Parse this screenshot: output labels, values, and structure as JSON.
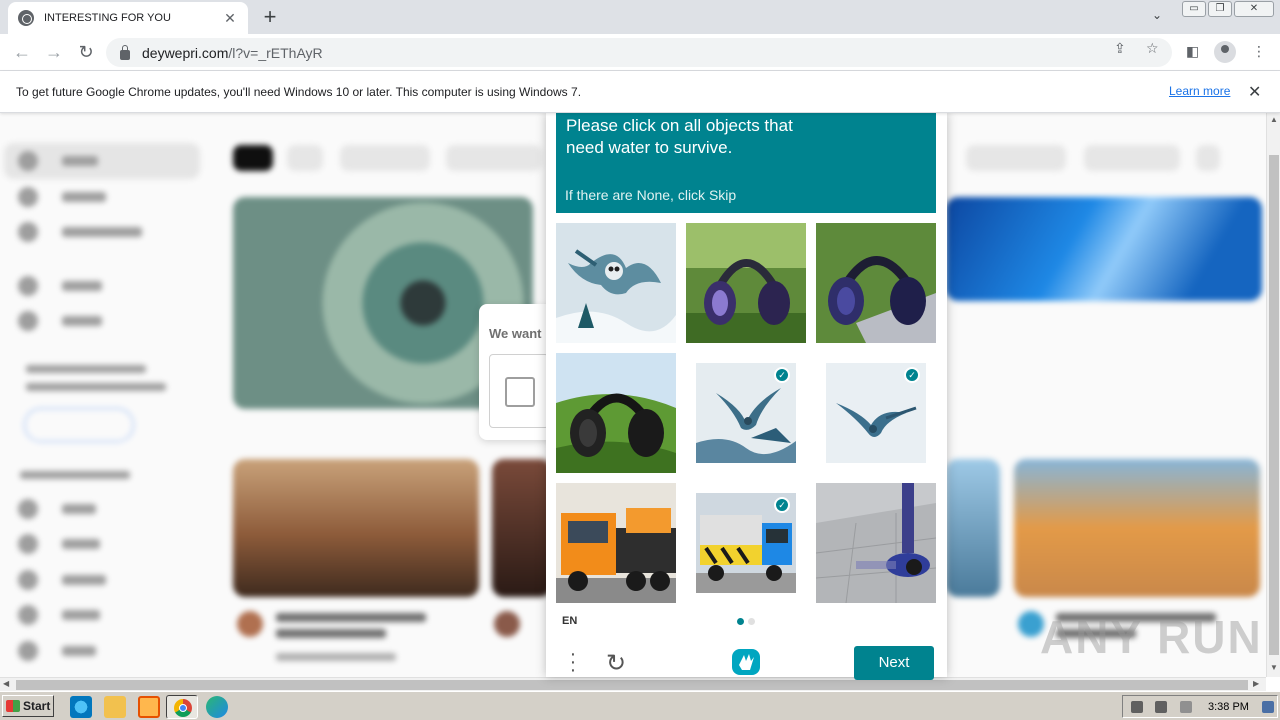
{
  "browser": {
    "tab_title": "INTERESTING FOR YOU",
    "tab_close": "✕",
    "new_tab": "+",
    "url_host": "deywepri.com",
    "url_path": "/l?v=_rEThAyR",
    "window_controls": [
      "▭",
      "❐",
      "✕"
    ]
  },
  "infobar": {
    "message": "To get future Google Chrome updates, you'll need Windows 10 or later. This computer is using Windows 7.",
    "link": "Learn more",
    "close": "✕"
  },
  "background_card": {
    "text": "We want"
  },
  "captcha": {
    "prompt": "Please click on all objects that need water to survive.",
    "skip_hint": "If there are None, click Skip",
    "accent_color": "#00838f",
    "tiles": [
      {
        "subject": "owl-flying-snow",
        "selected": false
      },
      {
        "subject": "headphones-on-grass",
        "selected": false
      },
      {
        "subject": "headphones-on-laptop",
        "selected": false
      },
      {
        "subject": "headphones-on-hill",
        "selected": false
      },
      {
        "subject": "bird-over-snow",
        "selected": true
      },
      {
        "subject": "bird-flying",
        "selected": true
      },
      {
        "subject": "orange-truck",
        "selected": false
      },
      {
        "subject": "yellow-blue-truck",
        "selected": true
      },
      {
        "subject": "scooter-on-sidewalk",
        "selected": false
      }
    ],
    "language": "EN",
    "page_indicator": {
      "current": 1,
      "total": 2
    },
    "next_label": "Next",
    "checkmark": "✓"
  },
  "watermark": "ANY RUN",
  "taskbar": {
    "start_label": "Start",
    "clock": "3:38 PM"
  }
}
